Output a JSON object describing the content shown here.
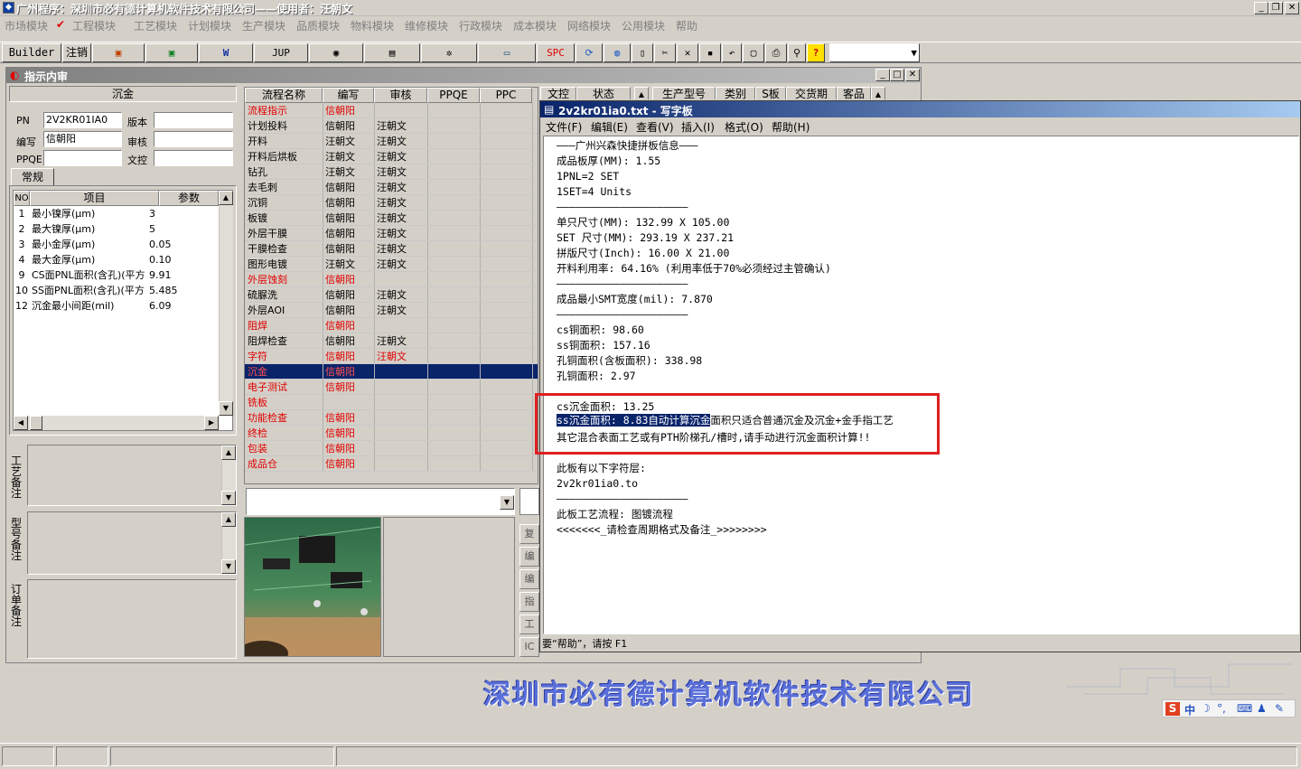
{
  "app": {
    "title": "广州程序：深圳市必有德计算机软件技术有限公司——使用者：汪朝文"
  },
  "menu": [
    "市场模块",
    "工程模块",
    "工艺模块",
    "计划模块",
    "生产模块",
    "品质模块",
    "物料模块",
    "维修模块",
    "行政模块",
    "成本模块",
    "网络模块",
    "公用模块",
    "帮助"
  ],
  "toolbar": {
    "builder": "Builder",
    "logout": "注销",
    "jup": "JUP",
    "spc": "SPC"
  },
  "child": {
    "title": "指示内审",
    "process_name": "沉金"
  },
  "form": {
    "pn_label": "PN",
    "pn_value": "2V2KR01IA0",
    "version_label": "版本",
    "version_value": "",
    "editor_label": "编写",
    "editor_value": "信朝阳",
    "review_label": "审核",
    "review_value": "",
    "ppqe_label": "PPQE",
    "ppqe_value": "",
    "wenkong_label": "文控",
    "wenkong_value": "",
    "tab": "常规"
  },
  "params": {
    "headers": [
      "NO",
      "项目",
      "参数"
    ],
    "rows": [
      [
        "1",
        "最小镍厚(μm)",
        "3"
      ],
      [
        "2",
        "最大镍厚(μm)",
        "5"
      ],
      [
        "3",
        "最小金厚(μm)",
        "0.05"
      ],
      [
        "4",
        "最大金厚(μm)",
        "0.10"
      ],
      [
        "9",
        "CS面PNL面积(含孔)(平方",
        "9.91"
      ],
      [
        "10",
        "SS面PNL面积(含孔)(平方",
        "5.485"
      ],
      [
        "12",
        "沉金最小间距(mil)",
        "6.09"
      ]
    ]
  },
  "notes": {
    "craft": "工艺备注",
    "model": "型号备注",
    "order": "订单备注"
  },
  "flow": {
    "headers": [
      "流程名称",
      "编写",
      "审核",
      "PPQE",
      "PPC",
      "文控",
      "状态"
    ],
    "rows": [
      {
        "name": "流程指示",
        "editor": "信朝阳",
        "reviewer": "",
        "red": true
      },
      {
        "name": "计划投料",
        "editor": "信朝阳",
        "reviewer": "汪朝文",
        "red": false
      },
      {
        "name": "开料",
        "editor": "汪朝文",
        "reviewer": "汪朝文",
        "red": false
      },
      {
        "name": "开料后烘板",
        "editor": "汪朝文",
        "reviewer": "汪朝文",
        "red": false
      },
      {
        "name": "钻孔",
        "editor": "汪朝文",
        "reviewer": "汪朝文",
        "red": false
      },
      {
        "name": "去毛刺",
        "editor": "信朝阳",
        "reviewer": "汪朝文",
        "red": false
      },
      {
        "name": "沉铜",
        "editor": "信朝阳",
        "reviewer": "汪朝文",
        "red": false
      },
      {
        "name": "板镀",
        "editor": "信朝阳",
        "reviewer": "汪朝文",
        "red": false
      },
      {
        "name": "外层干膜",
        "editor": "信朝阳",
        "reviewer": "汪朝文",
        "red": false
      },
      {
        "name": "干膜检查",
        "editor": "信朝阳",
        "reviewer": "汪朝文",
        "red": false
      },
      {
        "name": "图形电镀",
        "editor": "汪朝文",
        "reviewer": "汪朝文",
        "red": false
      },
      {
        "name": "外层蚀刻",
        "editor": "信朝阳",
        "reviewer": "",
        "red": true
      },
      {
        "name": "硫脲洗",
        "editor": "信朝阳",
        "reviewer": "汪朝文",
        "red": false
      },
      {
        "name": "外层AOI",
        "editor": "信朝阳",
        "reviewer": "汪朝文",
        "red": false
      },
      {
        "name": "阻焊",
        "editor": "信朝阳",
        "reviewer": "",
        "red": true
      },
      {
        "name": "阻焊检查",
        "editor": "信朝阳",
        "reviewer": "汪朝文",
        "red": false
      },
      {
        "name": "字符",
        "editor": "信朝阳",
        "reviewer": "汪朝文",
        "red": true
      },
      {
        "name": "沉金",
        "editor": "信朝阳",
        "reviewer": "",
        "red": true,
        "selected": true
      },
      {
        "name": "电子测试",
        "editor": "信朝阳",
        "reviewer": "",
        "red": true
      },
      {
        "name": "铣板",
        "editor": "",
        "reviewer": "",
        "red": true
      },
      {
        "name": "功能检查",
        "editor": "信朝阳",
        "reviewer": "",
        "red": true
      },
      {
        "name": "终检",
        "editor": "信朝阳",
        "reviewer": "",
        "red": true
      },
      {
        "name": "包装",
        "editor": "信朝阳",
        "reviewer": "",
        "red": true
      },
      {
        "name": "成品仓",
        "editor": "信朝阳",
        "reviewer": "",
        "red": true
      }
    ]
  },
  "right_headers": [
    "生产型号",
    "类别",
    "S板",
    "交货期",
    "客品"
  ],
  "side_buttons": [
    "复",
    "编",
    "编",
    "指",
    "工",
    "IC"
  ],
  "wordpad": {
    "title": "2v2kr01ia0.txt - 写字板",
    "menu": [
      "文件(F)",
      "编辑(E)",
      "查看(V)",
      "插入(I)",
      "格式(O)",
      "帮助(H)"
    ],
    "lines": [
      "———广州兴森快捷拼板信息———",
      "成品板厚(MM): 1.55",
      "1PNL=2 SET",
      "1SET=4 Units",
      "—————————————————————",
      "单只尺寸(MM): 132.99 X 105.00",
      "SET 尺寸(MM): 293.19 X 237.21",
      "拼版尺寸(Inch): 16.00 X 21.00",
      "开料利用率: 64.16% (利用率低于70%必须经过主管确认)",
      "—————————————————————",
      "成品最小SMT宽度(mil): 7.870",
      "—————————————————————",
      "cs铜面积: 98.60",
      "ss铜面积: 157.16",
      "孔铜面积(含板面积): 338.98",
      "孔铜面积: 2.97",
      "",
      "cs沉金面积: 13.25",
      "",
      "其它混合表面工艺或有PTH阶梯孔/槽时,请手动进行沉金面积计算!!",
      "—————————————————————",
      "此板有以下字符层:",
      "2v2kr01ia0.to",
      "—————————————————————",
      "此板工艺流程: 图镀流程",
      "<<<<<<<_请检查周期格式及备注_>>>>>>>>"
    ],
    "selected_text": "ss沉金面积: 8.83自动计算沉金",
    "after_selection": "面积只适合普通沉金及沉金+金手指工艺",
    "status": "要“帮助”，请按 F1"
  },
  "company_logo": "深圳市必有德计算机软件技术有限公司",
  "ime": {
    "lang": "中"
  }
}
